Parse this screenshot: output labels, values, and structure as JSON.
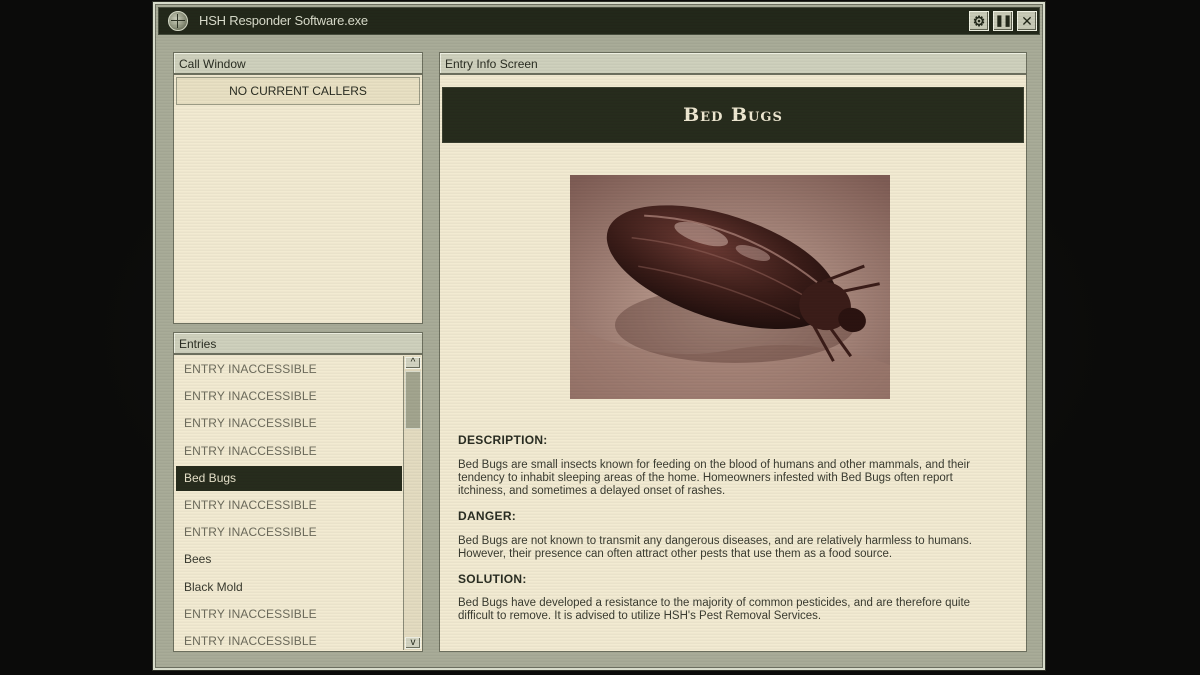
{
  "window": {
    "title": "HSH Responder Software.exe",
    "icon": "globe-icon",
    "buttons": {
      "settings_icon": "gear-icon",
      "pause_icon": "pause-icon",
      "close_icon": "close-icon"
    }
  },
  "call_window": {
    "header": "Call Window",
    "status": "NO CURRENT CALLERS"
  },
  "entries": {
    "header": "Entries",
    "scroll_up": "^",
    "scroll_down": "v",
    "items": [
      {
        "label": "ENTRY INACCESSIBLE",
        "locked": true
      },
      {
        "label": "ENTRY INACCESSIBLE",
        "locked": true
      },
      {
        "label": "ENTRY INACCESSIBLE",
        "locked": true
      },
      {
        "label": "ENTRY INACCESSIBLE",
        "locked": true
      },
      {
        "label": "Bed Bugs",
        "locked": false,
        "selected": true
      },
      {
        "label": "ENTRY INACCESSIBLE",
        "locked": true
      },
      {
        "label": "ENTRY INACCESSIBLE",
        "locked": true
      },
      {
        "label": "Bees",
        "locked": false
      },
      {
        "label": "Black Mold",
        "locked": false
      },
      {
        "label": "ENTRY INACCESSIBLE",
        "locked": true
      },
      {
        "label": "ENTRY INACCESSIBLE",
        "locked": true
      }
    ]
  },
  "entry_info": {
    "header": "Entry Info Screen",
    "title": "Bed Bugs",
    "image_subject": "bed-bug-photo",
    "description_heading": "DESCRIPTION:",
    "description_text": "Bed Bugs are small insects known for feeding on the blood of humans and other mammals, and their tendency to inhabit sleeping areas of the home. Homeowners infested with Bed Bugs often report itchiness, and sometimes a delayed onset of rashes.",
    "danger_heading": "DANGER:",
    "danger_text": "Bed Bugs are not known to transmit any dangerous diseases, and are relatively harmless to humans. However, their presence can often attract other pests that use them as a food source.",
    "solution_heading": "SOLUTION:",
    "solution_text": "Bed Bugs have developed a resistance to the majority of common pesticides, and are therefore quite difficult to remove. It is advised to utilize HSH's Pest Removal Services."
  },
  "colors": {
    "titlebar": "#23281a",
    "panel_bg": "#f2ebd2",
    "selected_bg": "#272c1d",
    "frame": "#a9ac98"
  }
}
